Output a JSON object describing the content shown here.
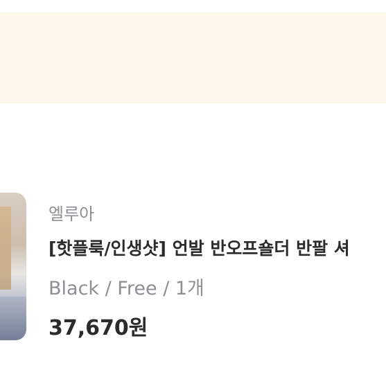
{
  "product": {
    "seller": "엘루아",
    "title": "[핫플룩/인생샷] 언발 반오프숄더 반팔 셔",
    "option": "Black / Free / 1개",
    "price": "37,670원"
  },
  "colors": {
    "top_band": "#fdf7ea",
    "text_primary": "#2b2b2b",
    "text_secondary": "#8e8e93"
  }
}
